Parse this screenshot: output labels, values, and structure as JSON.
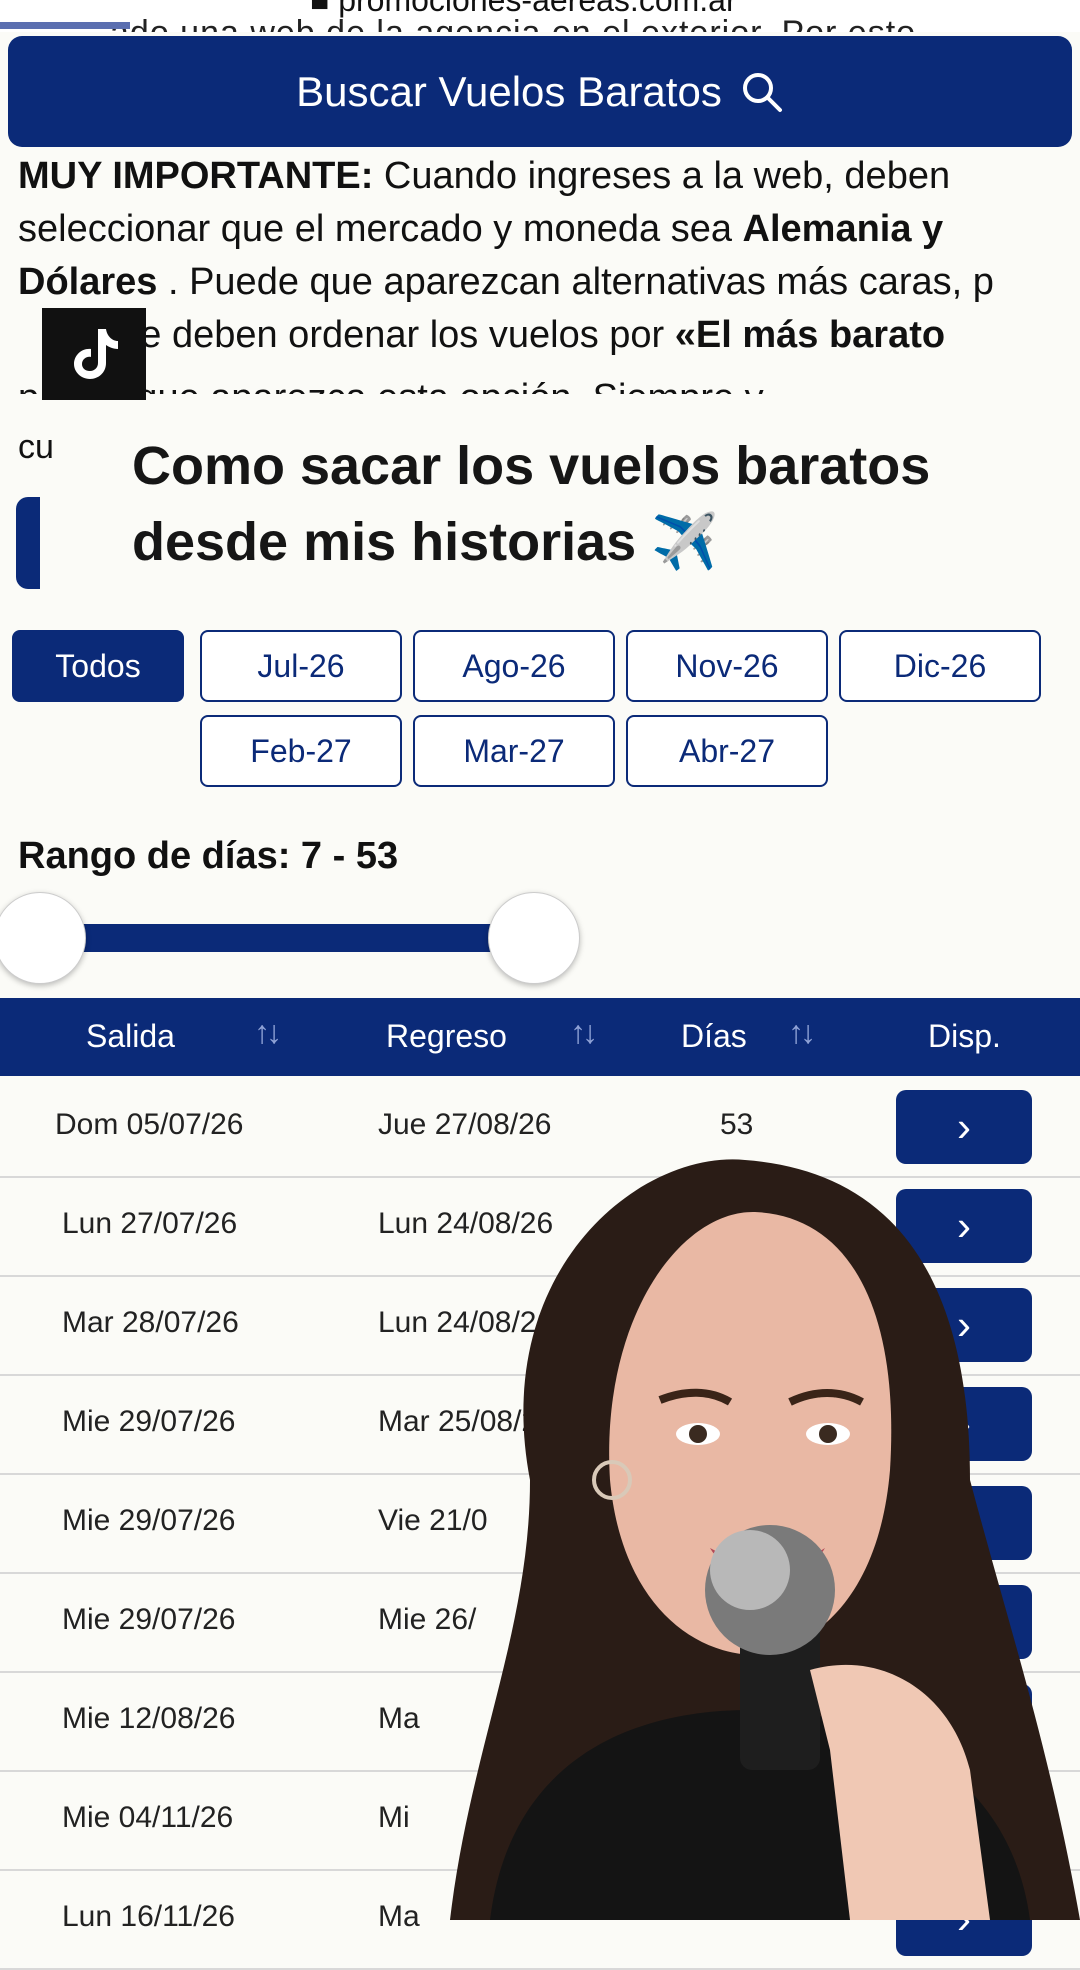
{
  "browser": {
    "url": "promociones-aereas.com.ar",
    "behind_text": "ado una web de la agencia en el exterior. Por esto"
  },
  "search_button": {
    "label": "Buscar Vuelos Baratos",
    "icon": "search-icon"
  },
  "intro": {
    "p1_bold": "MUY IMPORTANTE:",
    "p1_text": " Cuando ingreses a la web, deben seleccionar que el mercado y moneda sea ",
    "p1_bold2": "Alemania y Dólares",
    "p1_text2": " . Puede que aparezcan alternativas más caras, p",
    "p1_text3": "que deben ordenar los vuelos por ",
    "p1_bold3": "«El más barato",
    "cut_text": "p                 para que aparezca esta opción. Siempre y",
    "cu": "cu"
  },
  "overlay": {
    "title": "Como sacar los vuelos baratos desde mis historias ✈️"
  },
  "filters": {
    "chips": [
      "Todos",
      "Jul-26",
      "Ago-26",
      "Nov-26",
      "Dic-26",
      "Feb-27",
      "Mar-27",
      "Abr-27"
    ],
    "active": "Todos"
  },
  "range": {
    "label": "Rango de días: 7 - 53",
    "min": 7,
    "max": 53
  },
  "table": {
    "headers": [
      "Salida",
      "Regreso",
      "Días",
      "Disp."
    ],
    "sort_icon": "↑↓",
    "rows": [
      {
        "salida": "Dom 05/07/26",
        "regreso": "Jue 27/08/26",
        "dias": "53"
      },
      {
        "salida": "Lun 27/07/26",
        "regreso": "Lun 24/08/26",
        "dias": ""
      },
      {
        "salida": "Mar 28/07/26",
        "regreso": "Lun 24/08/26",
        "dias": ""
      },
      {
        "salida": "Mie 29/07/26",
        "regreso": "Mar 25/08/2",
        "dias": ""
      },
      {
        "salida": "Mie 29/07/26",
        "regreso": "Vie 21/0",
        "dias": ""
      },
      {
        "salida": "Mie 29/07/26",
        "regreso": "Mie 26/",
        "dias": ""
      },
      {
        "salida": "Mie 12/08/26",
        "regreso": "Ma",
        "dias": ""
      },
      {
        "salida": "Mie 04/11/26",
        "regreso": "Mi",
        "dias": ""
      },
      {
        "salida": "Lun 16/11/26",
        "regreso": "Ma",
        "dias": ""
      }
    ],
    "action_glyph": "›"
  },
  "colors": {
    "brand": "#0b2a78",
    "background": "#fbfbf7"
  }
}
